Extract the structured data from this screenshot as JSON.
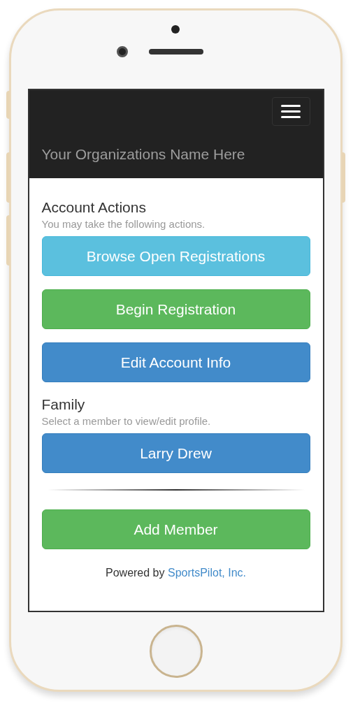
{
  "navbar": {
    "title": "Your Organizations Name Here"
  },
  "sections": [
    {
      "heading": "Account Actions",
      "subtitle": "You may take the following actions.",
      "buttons": [
        {
          "label": "Browse Open Registrations",
          "kind": "info"
        },
        {
          "label": "Begin Registration",
          "kind": "success"
        },
        {
          "label": "Edit Account Info",
          "kind": "primary"
        }
      ]
    },
    {
      "heading": "Family",
      "subtitle": "Select a member to view/edit profile.",
      "buttons": [
        {
          "label": "Larry Drew",
          "kind": "primary"
        }
      ]
    }
  ],
  "add_button": {
    "label": "Add Member",
    "kind": "success"
  },
  "footer": {
    "text": "Powered by",
    "link": "SportsPilot, Inc."
  }
}
